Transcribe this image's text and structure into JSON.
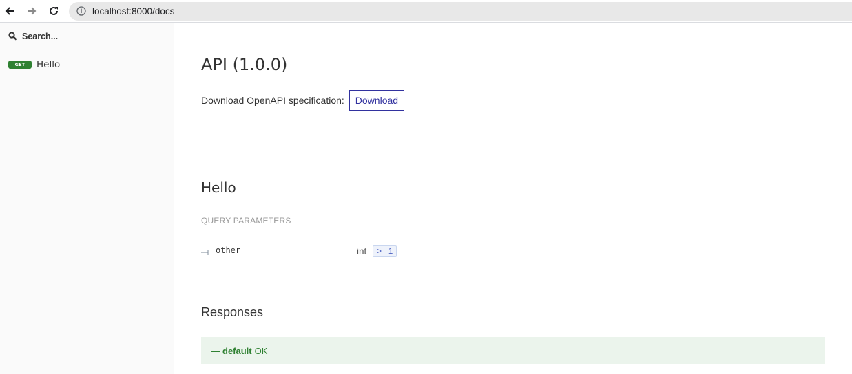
{
  "browser": {
    "url": "localhost:8000/docs",
    "icons": [
      "back-icon",
      "forward-icon",
      "reload-icon",
      "info-icon"
    ]
  },
  "sidebar": {
    "search_placeholder": "Search...",
    "items": [
      {
        "method": "GET",
        "label": "Hello",
        "method_color": "#2f8132"
      }
    ]
  },
  "main": {
    "title": "API (1.0.0)",
    "download_label": "Download OpenAPI specification:",
    "download_button": "Download",
    "operation_title": "Hello",
    "query_params_heading": "QUERY PARAMETERS",
    "params": [
      {
        "name": "other",
        "type": "int",
        "constraint": ">= 1"
      }
    ],
    "responses_title": "Responses",
    "responses": [
      {
        "dash": "—",
        "code": "default",
        "description": "OK",
        "color": "#2f8132"
      }
    ]
  },
  "colors": {
    "accent": "#32329f",
    "success": "#2f8132",
    "success_bg": "#ebf4ec",
    "sidebar_bg": "#fafafa"
  }
}
